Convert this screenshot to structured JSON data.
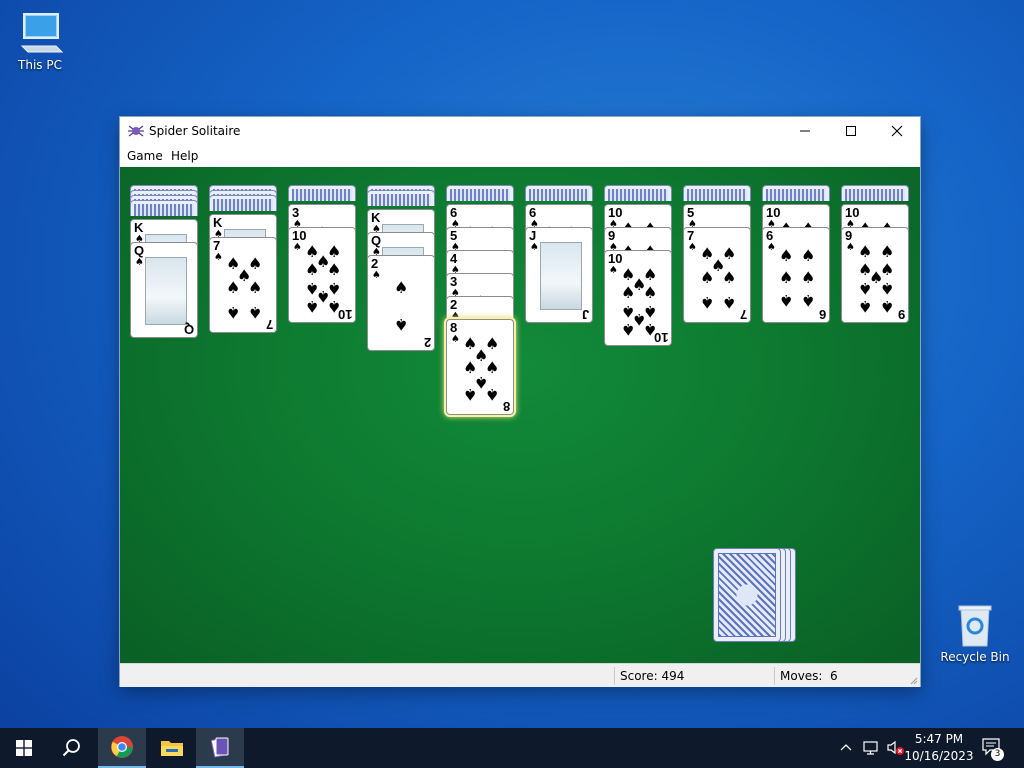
{
  "desktop": {
    "icons": [
      {
        "label": "This PC"
      },
      {
        "label": "Recycle Bin"
      }
    ]
  },
  "window": {
    "title": "Spider Solitaire",
    "menu": [
      "Game",
      "Help"
    ],
    "status": {
      "score_label": "Score: 494",
      "moves_label": "Moves:",
      "moves_value": "6"
    }
  },
  "piles": [
    {
      "backs": 4,
      "cards": [
        {
          "rank": "K",
          "face": true
        },
        {
          "rank": "Q",
          "face": true,
          "full": true
        }
      ]
    },
    {
      "backs": 3,
      "cards": [
        {
          "rank": "K",
          "face": true
        },
        {
          "rank": "7",
          "full": true
        }
      ]
    },
    {
      "backs": 1,
      "cards": [
        {
          "rank": "3"
        },
        {
          "rank": "10",
          "full": true
        }
      ]
    },
    {
      "backs": 2,
      "cards": [
        {
          "rank": "K",
          "face": true
        },
        {
          "rank": "Q",
          "face": true
        },
        {
          "rank": "2",
          "full": true
        }
      ]
    },
    {
      "backs": 1,
      "cards": [
        {
          "rank": "6"
        },
        {
          "rank": "5"
        },
        {
          "rank": "4"
        },
        {
          "rank": "3"
        },
        {
          "rank": "2"
        },
        {
          "rank": "8",
          "full": true,
          "selected": true
        }
      ]
    },
    {
      "backs": 1,
      "cards": [
        {
          "rank": "6"
        },
        {
          "rank": "J",
          "face": true,
          "full": true
        }
      ]
    },
    {
      "backs": 1,
      "cards": [
        {
          "rank": "10"
        },
        {
          "rank": "9"
        },
        {
          "rank": "10",
          "full": true
        }
      ]
    },
    {
      "backs": 1,
      "cards": [
        {
          "rank": "5"
        },
        {
          "rank": "7",
          "full": true
        }
      ]
    },
    {
      "backs": 1,
      "cards": [
        {
          "rank": "10"
        },
        {
          "rank": "6",
          "full": true
        }
      ]
    },
    {
      "backs": 1,
      "cards": [
        {
          "rank": "10"
        },
        {
          "rank": "9",
          "full": true
        }
      ]
    }
  ],
  "stock": {
    "deals_remaining": 4
  },
  "taskbar": {
    "time": "5:47 PM",
    "date": "10/16/2023",
    "notification_count": "3",
    "apps": [
      "start-button",
      "search-button",
      "chrome-app",
      "file-explorer-app",
      "spider-solitaire-app"
    ]
  }
}
